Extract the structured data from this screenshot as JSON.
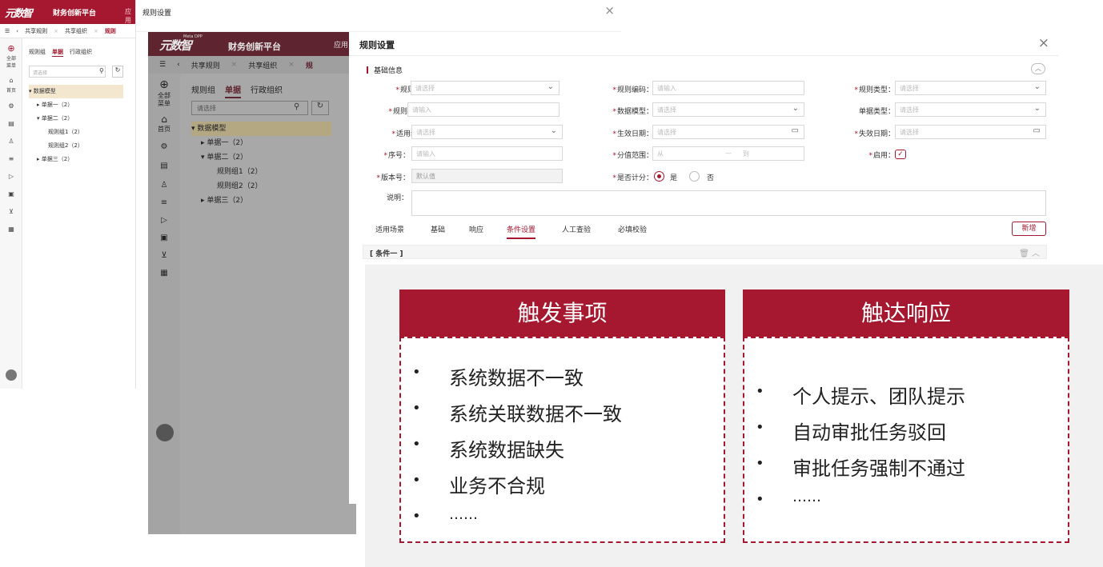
{
  "back_app": {
    "logo_text": "财务创新平台",
    "logo_mark": "元数智",
    "header_extra": "应用",
    "tabs": [
      "共享规则",
      "共享组织",
      "规则"
    ],
    "side_all_menu": "全部菜单",
    "side_home": "首页",
    "panel_tabs": [
      "规则组",
      "单据",
      "行政组织"
    ],
    "search_placeholder": "请选择",
    "tree": [
      "数据模型",
      "单据一（2）",
      "单据二（2）",
      "规则组1（2）",
      "规则组2（2）",
      "单据三（2）"
    ]
  },
  "mid_app": {
    "logo_small": "Meta DPP",
    "logo_mark": "元数智",
    "logo_text": "财务创新平台",
    "header_extra": "应用",
    "tabs": [
      "共享规则",
      "共享组织",
      "规"
    ],
    "side_all": "全部",
    "side_menu": "菜单",
    "side_home": "首页",
    "panel_tabs": [
      "规则组",
      "单据",
      "行政组织"
    ],
    "search_placeholder": "请选择",
    "tree": [
      "数据模型",
      "单据一（2）",
      "单据二（2）",
      "规则组1（2）",
      "规则组2（2）",
      "单据三（2）"
    ]
  },
  "back_dialog": {
    "title": "规则设置"
  },
  "dialog": {
    "title": "规则设置",
    "section_title": "基础信息",
    "fields": {
      "rule_group": {
        "label": "规则组：",
        "placeholder": "请选择"
      },
      "rule_code": {
        "label": "规则编码：",
        "placeholder": "请输入"
      },
      "rule_type": {
        "label": "规则类型：",
        "placeholder": "请选择"
      },
      "rule_name": {
        "label": "规则名称：",
        "placeholder": "请输入"
      },
      "data_model": {
        "label": "数据模型：",
        "placeholder": "请选择"
      },
      "doc_type": {
        "label": "单据类型：",
        "placeholder": "请选择"
      },
      "org": {
        "label": "适用组织：",
        "placeholder": "请选择"
      },
      "start_date": {
        "label": "生效日期：",
        "placeholder": "请选择"
      },
      "end_date": {
        "label": "失效日期：",
        "placeholder": "请选择"
      },
      "seq": {
        "label": "序号：",
        "placeholder": "请输入"
      },
      "score_range": {
        "label": "分值范围：",
        "from": "从",
        "dash": "—",
        "to": "到"
      },
      "enabled": {
        "label": "启用："
      },
      "version": {
        "label": "版本号：",
        "value": "默认值"
      },
      "scoring": {
        "label": "是否计分：",
        "yes": "是",
        "no": "否"
      },
      "desc": {
        "label": "说明："
      }
    },
    "subtabs": [
      "适用场景",
      "基础",
      "响应",
      "条件设置",
      "人工查验",
      "必填校验"
    ],
    "add_label": "新增",
    "condition_title": "[ 条件一 ]"
  },
  "overlay": {
    "left_title": "触发事项",
    "left_items": [
      "系统数据不一致",
      "系统关联数据不一致",
      "系统数据缺失",
      "业务不合规",
      "……"
    ],
    "right_title": "触达响应",
    "right_items": [
      "个人提示、团队提示",
      "自动审批任务驳回",
      "审批任务强制不通过",
      "……"
    ]
  }
}
